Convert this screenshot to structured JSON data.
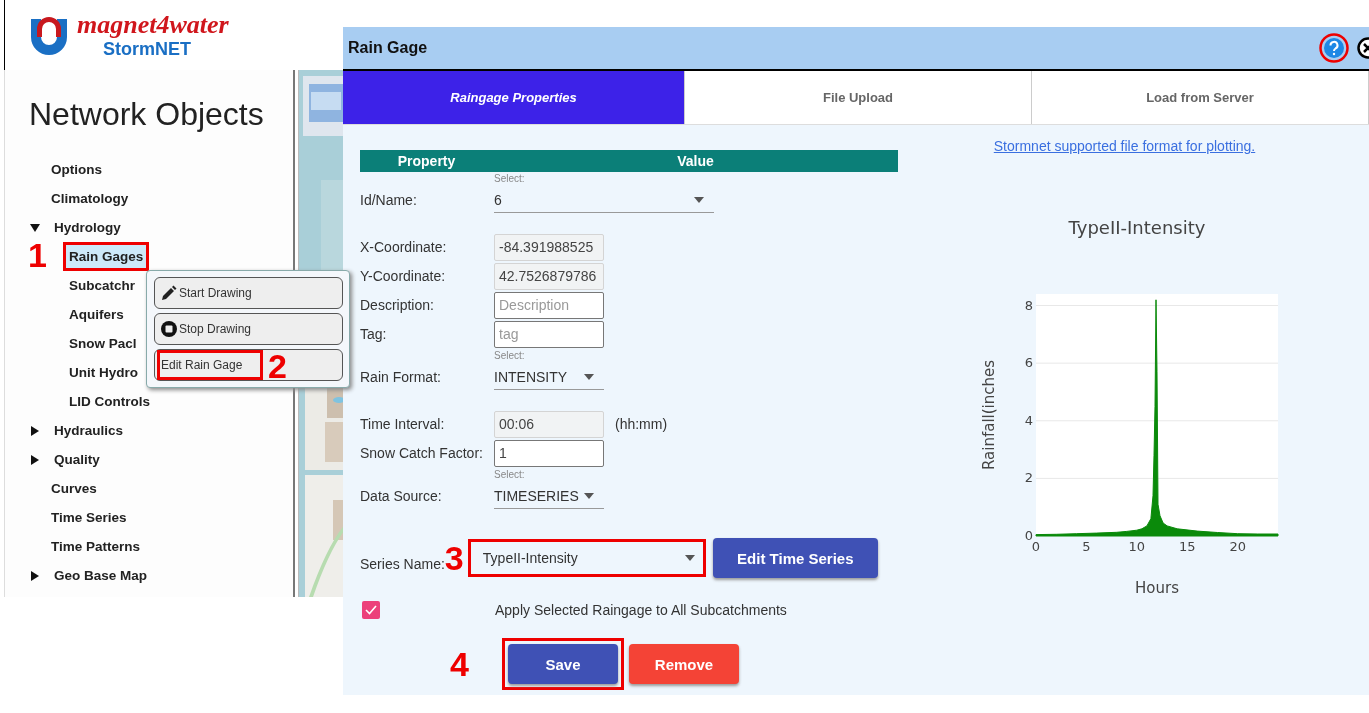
{
  "brand": {
    "name": "magnet4water",
    "product": "StormNET"
  },
  "sidebar": {
    "title": "Network Objects",
    "items": [
      {
        "label": "Options",
        "selected": false
      },
      {
        "label": "Climatology",
        "selected": false
      },
      {
        "label": "Hydrology",
        "selected": false,
        "expanded": true,
        "children": [
          {
            "label": "Rain Gages",
            "selected": true,
            "callout": "1"
          },
          {
            "label": "Subcatchr",
            "selected": false
          },
          {
            "label": "Aquifers",
            "selected": false
          },
          {
            "label": "Snow Pacl",
            "selected": false
          },
          {
            "label": "Unit Hydro",
            "selected": false
          },
          {
            "label": "LID Controls",
            "selected": false
          }
        ]
      },
      {
        "label": "Hydraulics",
        "selected": false,
        "expanded": false
      },
      {
        "label": "Quality",
        "selected": false,
        "expanded": false
      },
      {
        "label": "Curves",
        "selected": false
      },
      {
        "label": "Time Series",
        "selected": false
      },
      {
        "label": "Time Patterns",
        "selected": false
      },
      {
        "label": "Geo Base Map",
        "selected": false,
        "expanded": false
      }
    ]
  },
  "context_menu": [
    {
      "kind": "pencil",
      "label": "Start Drawing"
    },
    {
      "kind": "stop",
      "label": "Stop Drawing"
    },
    {
      "kind": "plain",
      "label": "Edit Rain Gage",
      "callout": "2"
    }
  ],
  "dialog": {
    "title": "Rain Gage",
    "tabs": [
      {
        "label": "Raingage Properties",
        "selected": true
      },
      {
        "label": "File Upload",
        "selected": false
      },
      {
        "label": "Load from Server",
        "selected": false
      }
    ],
    "columns": [
      "Property",
      "Value"
    ],
    "fields": [
      {
        "kind": "select",
        "label": "Id/Name:",
        "hint": "Select:",
        "value": "6",
        "wide": true
      },
      {
        "kind": "readonly",
        "label": "X-Coordinate:",
        "value": "-84.391988525"
      },
      {
        "kind": "readonly",
        "label": "Y-Coordinate:",
        "value": "42.7526879786"
      },
      {
        "kind": "input",
        "label": "Description:",
        "placeholder": "Description"
      },
      {
        "kind": "input",
        "label": "Tag:",
        "placeholder": "tag"
      },
      {
        "kind": "select",
        "label": "Rain Format:",
        "hint": "Select:",
        "value": "INTENSITY",
        "wide": false
      },
      {
        "kind": "readonly",
        "label": "Time Interval:",
        "value": "00:06",
        "unit": "(hh:mm)"
      },
      {
        "kind": "input",
        "label": "Snow Catch Factor:",
        "value": "1"
      },
      {
        "kind": "select",
        "label": "Data Source:",
        "hint": "Select:",
        "value": "TIMESERIES",
        "wide": false
      }
    ],
    "series": {
      "label": "Series Name:",
      "callout": "3",
      "value": "TypeII-Intensity",
      "button": "Edit Time Series"
    },
    "apply": {
      "checked": true,
      "label": "Apply Selected Raingage to All Subcatchments"
    },
    "actions": {
      "callout": "4",
      "save": "Save",
      "remove": "Remove"
    },
    "link": "Stormnet supported file format for plotting.",
    "chart_data": {
      "type": "area",
      "title": "TypeII-Intensity",
      "xlabel": "Hours",
      "ylabel": "Rainfall(inches",
      "x": [
        0,
        2,
        4,
        6,
        8,
        9,
        10,
        10.5,
        11,
        11.4,
        11.6,
        11.7,
        11.8,
        11.9,
        12.0,
        12.1,
        12.3,
        12.6,
        13,
        14,
        16,
        18,
        20,
        22,
        24
      ],
      "grid": true,
      "series": [
        {
          "color": "#0a8a0a",
          "values": [
            0.05,
            0.06,
            0.08,
            0.1,
            0.13,
            0.16,
            0.2,
            0.25,
            0.35,
            0.6,
            1.4,
            2.8,
            4.5,
            8.2,
            5.7,
            1.1,
            0.7,
            0.45,
            0.35,
            0.25,
            0.17,
            0.12,
            0.08,
            0.07,
            0.07
          ]
        }
      ],
      "xlim": [
        0,
        24
      ],
      "ylim": [
        0,
        8.4
      ],
      "xticks": [
        0,
        5,
        10,
        15,
        20
      ],
      "yticks": [
        0,
        2,
        4,
        6,
        8
      ]
    }
  }
}
